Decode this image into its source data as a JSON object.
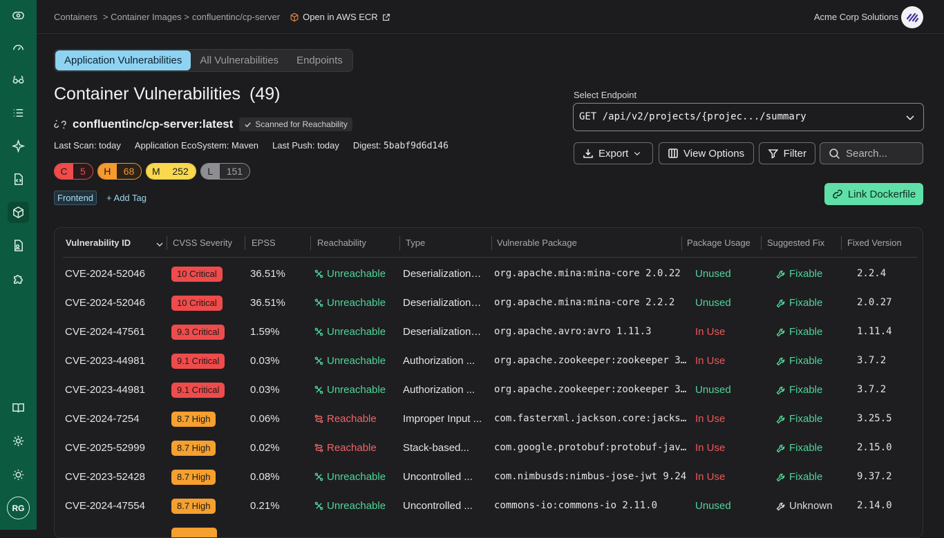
{
  "breadcrumb": {
    "items": [
      "Containers",
      "> Container Images >",
      "confluentinc/cp-server"
    ],
    "ecr_link": "Open in AWS ECR"
  },
  "org": {
    "name": "Acme Corp Solutions"
  },
  "user": {
    "initials": "RG"
  },
  "tabs": [
    "Application Vulnerabilities",
    "All Vulnerabilities",
    "Endpoints"
  ],
  "header": {
    "title": "Container Vulnerabilities",
    "count": "(49)",
    "image": "confluentinc/cp-server:latest",
    "scan_badge": "Scanned for Reachability",
    "meta": {
      "last_scan": "Last Scan: today",
      "ecosystem": "Application EcoSystem: Maven",
      "last_push": "Last Push: today",
      "digest_label": "Digest:",
      "digest": "5babf9d6d146"
    },
    "severity": [
      {
        "key": "C",
        "count": "5"
      },
      {
        "key": "H",
        "count": "68"
      },
      {
        "key": "M",
        "count": "252"
      },
      {
        "key": "L",
        "count": "151"
      }
    ],
    "tag": "Frontend",
    "add_tag": "+ Add Tag"
  },
  "endpoint": {
    "label": "Select Endpoint",
    "value": "GET /api/v2/projects/{projec.../summary"
  },
  "toolbar": {
    "export": "Export",
    "view_options": "View Options",
    "filter": "Filter",
    "search_placeholder": "Search...",
    "link_dockerfile": "Link Dockerfile"
  },
  "table": {
    "columns": [
      "Vulnerability ID",
      "CVSS Severity",
      "EPSS",
      "Reachability",
      "Type",
      "Vulnerable Package",
      "Package Usage",
      "Suggested Fix",
      "Fixed Version"
    ],
    "rows": [
      {
        "id": "CVE-2024-52046",
        "cvss": "10 Critical",
        "level": "crit",
        "epss": "36.51%",
        "reach": "Unreachable",
        "type": "Deserialization ...",
        "pkg": "org.apache.mina:mina-core 2.0.22",
        "usage": "Unused",
        "fix": "Fixable",
        "fixed": "2.2.4"
      },
      {
        "id": "CVE-2024-52046",
        "cvss": "10 Critical",
        "level": "crit",
        "epss": "36.51%",
        "reach": "Unreachable",
        "type": "Deserialization ...",
        "pkg": "org.apache.mina:mina-core 2.2.2",
        "usage": "Unused",
        "fix": "Fixable",
        "fixed": "2.0.27"
      },
      {
        "id": "CVE-2024-47561",
        "cvss": "9.3 Critical",
        "level": "crit",
        "epss": "1.59%",
        "reach": "Unreachable",
        "type": "Deserialization ...",
        "pkg": "org.apache.avro:avro 1.11.3",
        "usage": "In Use",
        "fix": "Fixable",
        "fixed": "1.11.4"
      },
      {
        "id": "CVE-2023-44981",
        "cvss": "9.1 Critical",
        "level": "crit",
        "epss": "0.03%",
        "reach": "Unreachable",
        "type": "Authorization ...",
        "pkg": "org.apache.zookeeper:zookeeper 3…",
        "usage": "In Use",
        "fix": "Fixable",
        "fixed": "3.7.2"
      },
      {
        "id": "CVE-2023-44981",
        "cvss": "9.1 Critical",
        "level": "crit",
        "epss": "0.03%",
        "reach": "Unreachable",
        "type": "Authorization ...",
        "pkg": "org.apache.zookeeper:zookeeper 3…",
        "usage": "Unused",
        "fix": "Fixable",
        "fixed": "3.7.2"
      },
      {
        "id": "CVE-2024-7254",
        "cvss": "8.7 High",
        "level": "high",
        "epss": "0.06%",
        "reach": "Reachable",
        "type": "Improper Input ...",
        "pkg": "com.fasterxml.jackson.core:jacks…",
        "usage": "In Use",
        "fix": "Fixable",
        "fixed": "3.25.5"
      },
      {
        "id": "CVE-2025-52999",
        "cvss": "8.7 High",
        "level": "high",
        "epss": "0.02%",
        "reach": "Reachable",
        "type": "Stack-based...",
        "pkg": "com.google.protobuf:protobuf-jav…",
        "usage": "In Use",
        "fix": "Fixable",
        "fixed": "2.15.0"
      },
      {
        "id": "CVE-2023-52428",
        "cvss": "8.7 High",
        "level": "high",
        "epss": "0.08%",
        "reach": "Unreachable",
        "type": "Uncontrolled ...",
        "pkg": "com.nimbusds:nimbus-jose-jwt 9.24",
        "usage": "In Use",
        "fix": "Fixable",
        "fixed": "9.37.2"
      },
      {
        "id": "CVE-2024-47554",
        "cvss": "8.7 High",
        "level": "high",
        "epss": "0.21%",
        "reach": "Unreachable",
        "type": "Uncontrolled ...",
        "pkg": "commons-io:commons-io 2.11.0",
        "usage": "Unused",
        "fix": "Unknown",
        "fixed": "2.14.0"
      }
    ]
  }
}
